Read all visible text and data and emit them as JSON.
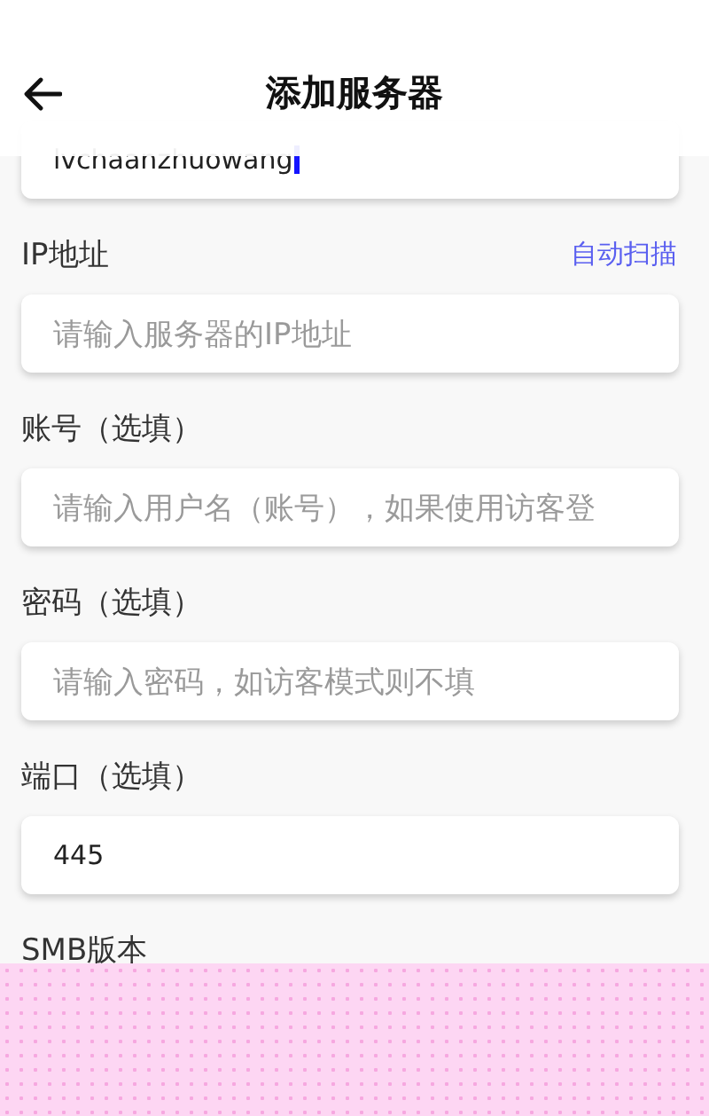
{
  "header": {
    "title": "添加服务器"
  },
  "fields": [
    {
      "value": "lvchaanzhuowang",
      "focused": true
    },
    {
      "label": "IP地址",
      "action": "自动扫描",
      "placeholder": "请输入服务器的IP地址",
      "focused": false
    },
    {
      "label": "账号（选填）",
      "placeholder": "请输入用户名（账号），如果使用访客登",
      "focused": false
    },
    {
      "label": "密码（选填）",
      "placeholder": "请输入密码，如访客模式则不填",
      "focused": false
    },
    {
      "label": "端口（选填）",
      "value": "445",
      "focused": false
    }
  ],
  "section_label": "SMB版本"
}
